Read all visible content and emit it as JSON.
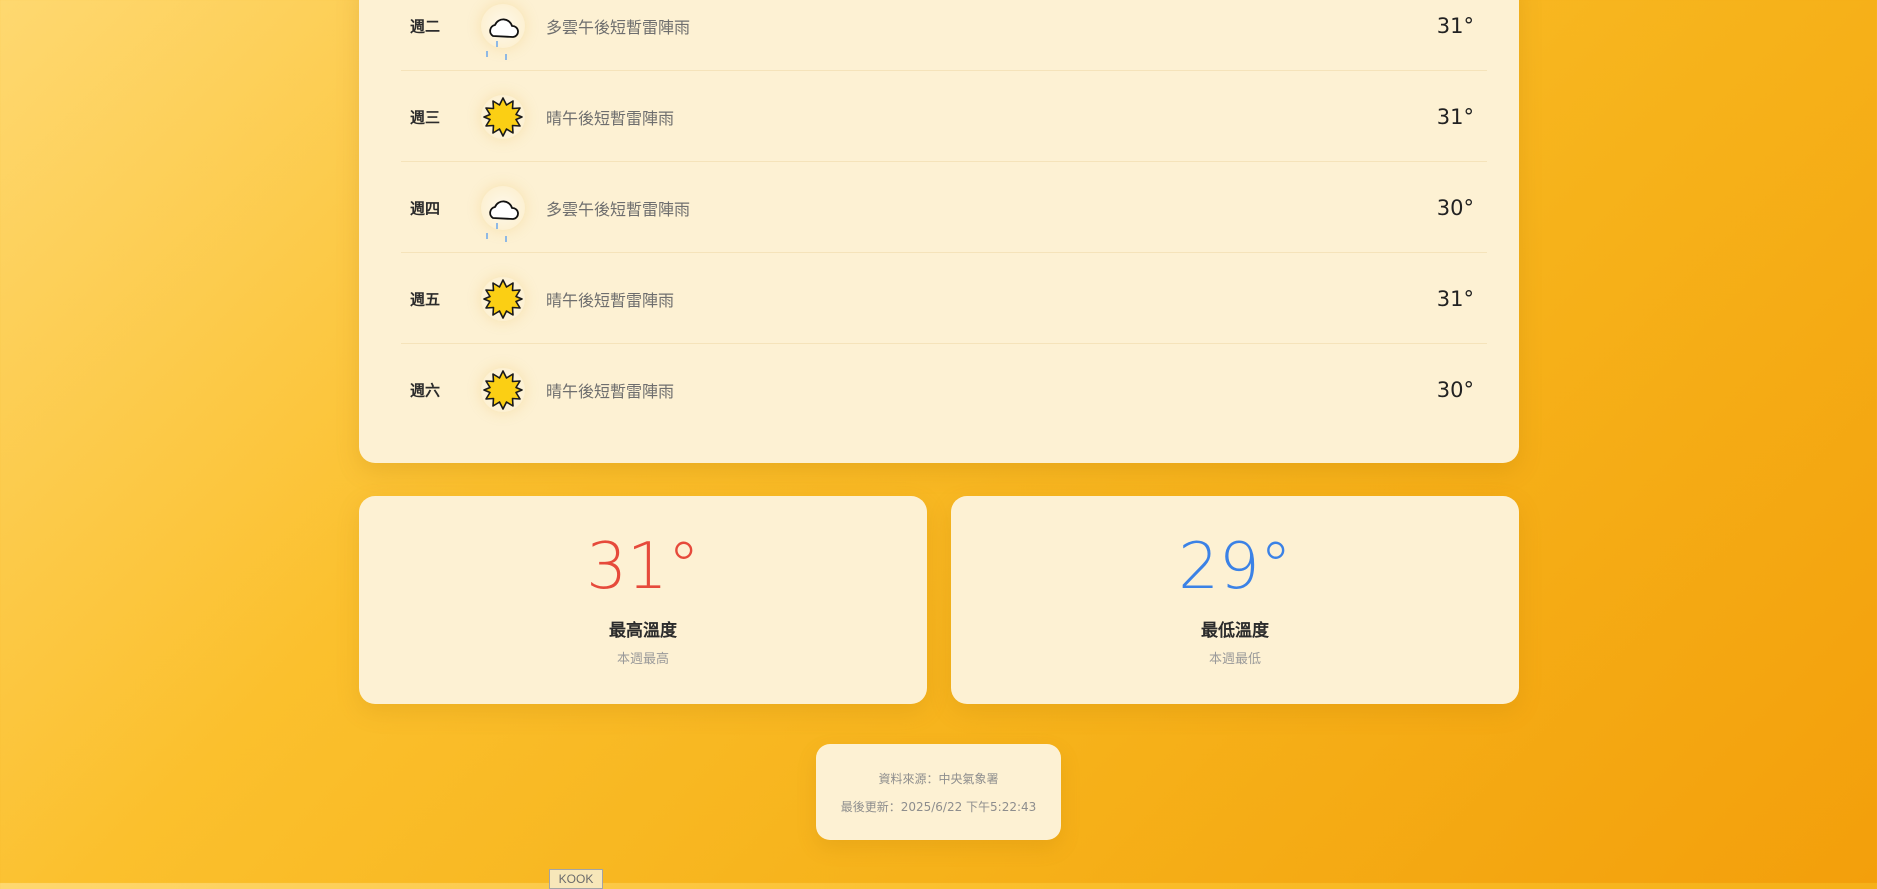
{
  "forecast": [
    {
      "day": "週二",
      "icon": "rain-cloud-icon",
      "description": "多雲午後短暫雷陣雨",
      "temp": "31°"
    },
    {
      "day": "週三",
      "icon": "sun-icon",
      "description": "晴午後短暫雷陣雨",
      "temp": "31°"
    },
    {
      "day": "週四",
      "icon": "rain-cloud-icon",
      "description": "多雲午後短暫雷陣雨",
      "temp": "30°"
    },
    {
      "day": "週五",
      "icon": "sun-icon",
      "description": "晴午後短暫雷陣雨",
      "temp": "31°"
    },
    {
      "day": "週六",
      "icon": "sun-icon",
      "description": "晴午後短暫雷陣雨",
      "temp": "30°"
    }
  ],
  "stats": {
    "high": {
      "value": "31°",
      "label": "最高溫度",
      "sub": "本週最高",
      "color": "#e64a3b"
    },
    "low": {
      "value": "29°",
      "label": "最低溫度",
      "sub": "本週最低",
      "color": "#3b82e6"
    }
  },
  "footer": {
    "source": "資料來源：中央氣象署",
    "updated": "最後更新：2025/6/22 下午5:22:43"
  },
  "badge": {
    "label": "KOOK"
  }
}
